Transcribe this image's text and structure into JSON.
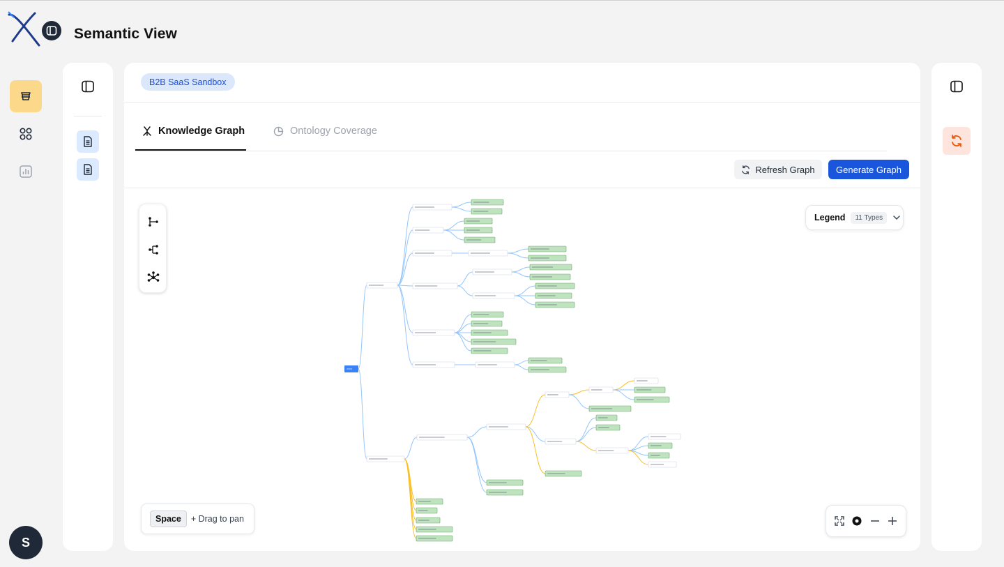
{
  "app": {
    "title": "Semantic View",
    "logo_icon": "x-logo-icon",
    "avatar_initial": "S"
  },
  "rail": [
    {
      "name": "datasets",
      "icon": "database-stack-icon",
      "active": true
    },
    {
      "name": "apps",
      "icon": "grid-icon",
      "active": false
    },
    {
      "name": "analytics",
      "icon": "bar-chart-icon",
      "active": false
    }
  ],
  "main": {
    "project_badge": "B2B SaaS Sandbox",
    "tabs": [
      {
        "label": "Knowledge Graph",
        "icon": "graph-icon",
        "active": true
      },
      {
        "label": "Ontology Coverage",
        "icon": "pie-chart-icon",
        "active": false
      }
    ],
    "actions": {
      "refresh_label": "Refresh Graph",
      "generate_label": "Generate Graph"
    },
    "legend": {
      "title": "Legend",
      "count": "11 Types"
    },
    "pan_hint": {
      "key": "Space",
      "text": "+ Drag to pan"
    }
  },
  "colors": {
    "accent": "#1a56db",
    "active_rail": "#fcd98a",
    "root_node": "#3b82f6",
    "leaf_node": "#bfe3bf",
    "edge_blue": "#93c5fd",
    "edge_orange": "#fbbf24"
  }
}
